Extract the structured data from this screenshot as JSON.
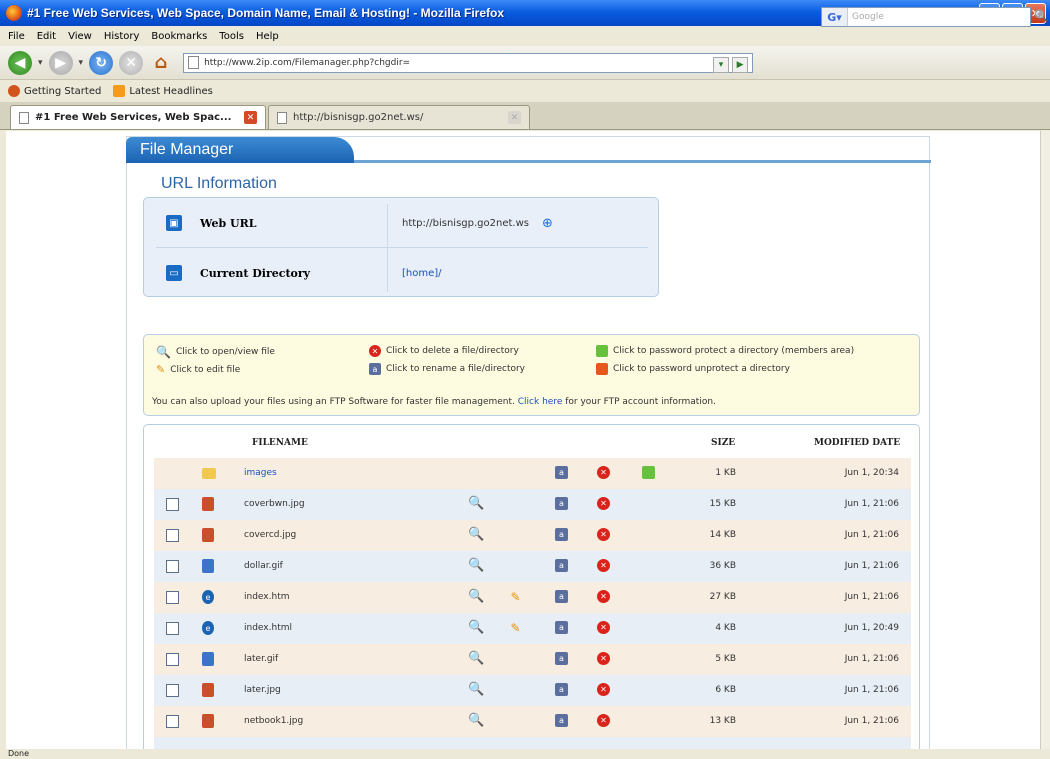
{
  "window": {
    "title": "#1 Free Web Services, Web Space, Domain Name, Email & Hosting! - Mozilla Firefox"
  },
  "menu": [
    "File",
    "Edit",
    "View",
    "History",
    "Bookmarks",
    "Tools",
    "Help"
  ],
  "nav": {
    "url": "http://www.2ip.com/Filemanager.php?chgdir=",
    "search_placeholder": "Google"
  },
  "bookmarks": [
    "Getting Started",
    "Latest Headlines"
  ],
  "tabs": [
    {
      "label": "#1 Free Web Services, Web Spac...",
      "active": true
    },
    {
      "label": "http://bisnisgp.go2net.ws/",
      "active": false
    }
  ],
  "status": "Done",
  "file_manager": {
    "title": "File Manager",
    "url_info": {
      "heading": "URL Information",
      "web_url_label": "Web URL",
      "web_url_value": "http://bisnisgp.go2net.ws",
      "current_dir_label": "Current Directory",
      "current_dir_value": "[home]/"
    },
    "legend": {
      "open": "Click to open/view file",
      "edit": "Click to edit file",
      "delete": "Click to delete a file/directory",
      "rename": "Click to rename a file/directory",
      "protect": "Click to password protect a directory (members area)",
      "unprotect": "Click to password unprotect a directory",
      "note_pre": "You can also upload your files using an FTP Software for faster file management.",
      "note_link": "Click here",
      "note_post": "for your FTP account information."
    },
    "columns": {
      "filename": "FILENAME",
      "size": "SIZE",
      "modified": "MODIFIED DATE"
    },
    "files": [
      {
        "name": "images",
        "size": "1 KB",
        "date": "Jun 1, 20:34"
      },
      {
        "name": "coverbwn.jpg",
        "size": "15 KB",
        "date": "Jun 1, 21:06"
      },
      {
        "name": "covercd.jpg",
        "size": "14 KB",
        "date": "Jun 1, 21:06"
      },
      {
        "name": "dollar.gif",
        "size": "36 KB",
        "date": "Jun 1, 21:06"
      },
      {
        "name": "index.htm",
        "size": "27 KB",
        "date": "Jun 1, 21:06"
      },
      {
        "name": "index.html",
        "size": "4 KB",
        "date": "Jun 1, 20:49"
      },
      {
        "name": "later.gif",
        "size": "5 KB",
        "date": "Jun 1, 21:06"
      },
      {
        "name": "later.jpg",
        "size": "6 KB",
        "date": "Jun 1, 21:06"
      },
      {
        "name": "netbook1.jpg",
        "size": "13 KB",
        "date": "Jun 1, 21:06"
      }
    ]
  },
  "colors": {
    "titlebar": "#0a5de0",
    "accent": "#1b63b3",
    "delete": "#d9231b"
  }
}
